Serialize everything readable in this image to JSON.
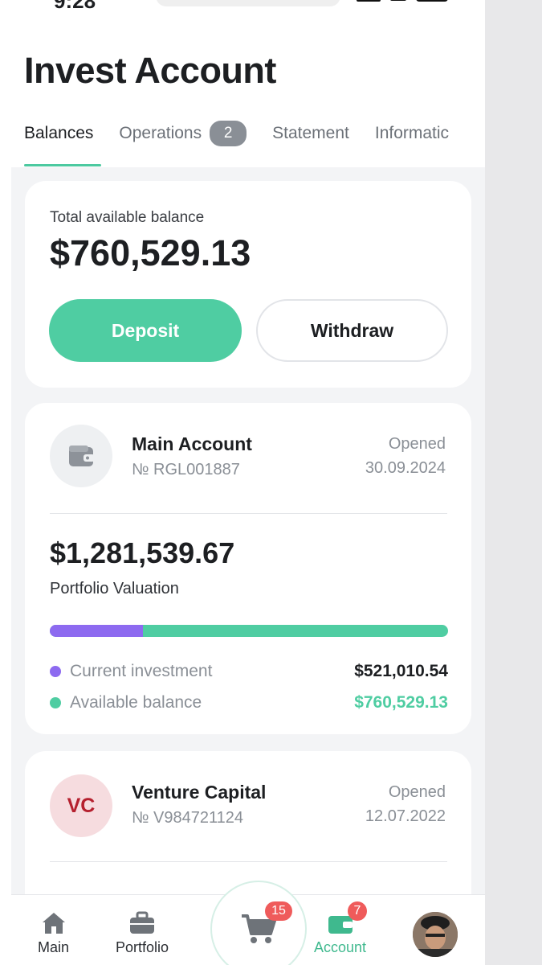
{
  "status_bar": {
    "time": "9:28"
  },
  "header": {
    "title": "Invest Account",
    "tabs": [
      {
        "label": "Balances"
      },
      {
        "label": "Operations",
        "badge": "2"
      },
      {
        "label": "Statement"
      },
      {
        "label": "Informatic"
      }
    ]
  },
  "balance_card": {
    "label": "Total available balance",
    "value": "$760,529.13",
    "deposit_label": "Deposit",
    "withdraw_label": "Withdraw"
  },
  "main_account": {
    "name": "Main Account",
    "number": "№ RGL001887",
    "opened_label": "Opened",
    "opened_date": "30.09.2024",
    "valuation_value": "$1,281,539.67",
    "valuation_label": "Portfolio Valuation",
    "investment_share": 0.234,
    "legend": [
      {
        "label": "Current investment",
        "value": "$521,010.54",
        "color": "#8d6af0"
      },
      {
        "label": "Available balance",
        "value": "$760,529.13",
        "color": "#4fcda2"
      }
    ]
  },
  "venture_account": {
    "initials": "VC",
    "name": "Venture Capital",
    "number": "№ V984721124",
    "opened_label": "Opened",
    "opened_date": "12.07.2022"
  },
  "bottom_nav": {
    "items": [
      {
        "label": "Main",
        "icon": "home-icon"
      },
      {
        "label": "Portfolio",
        "icon": "briefcase-icon"
      },
      {
        "label": "",
        "icon": "cart-icon",
        "badge": "15"
      },
      {
        "label": "Account",
        "icon": "wallet-icon",
        "badge": "7"
      },
      {
        "label": "",
        "icon": "avatar"
      }
    ]
  },
  "colors": {
    "accent": "#4fcda2",
    "investment": "#8d6af0",
    "badge": "#ef5b5b",
    "vc_text": "#b5202e"
  }
}
